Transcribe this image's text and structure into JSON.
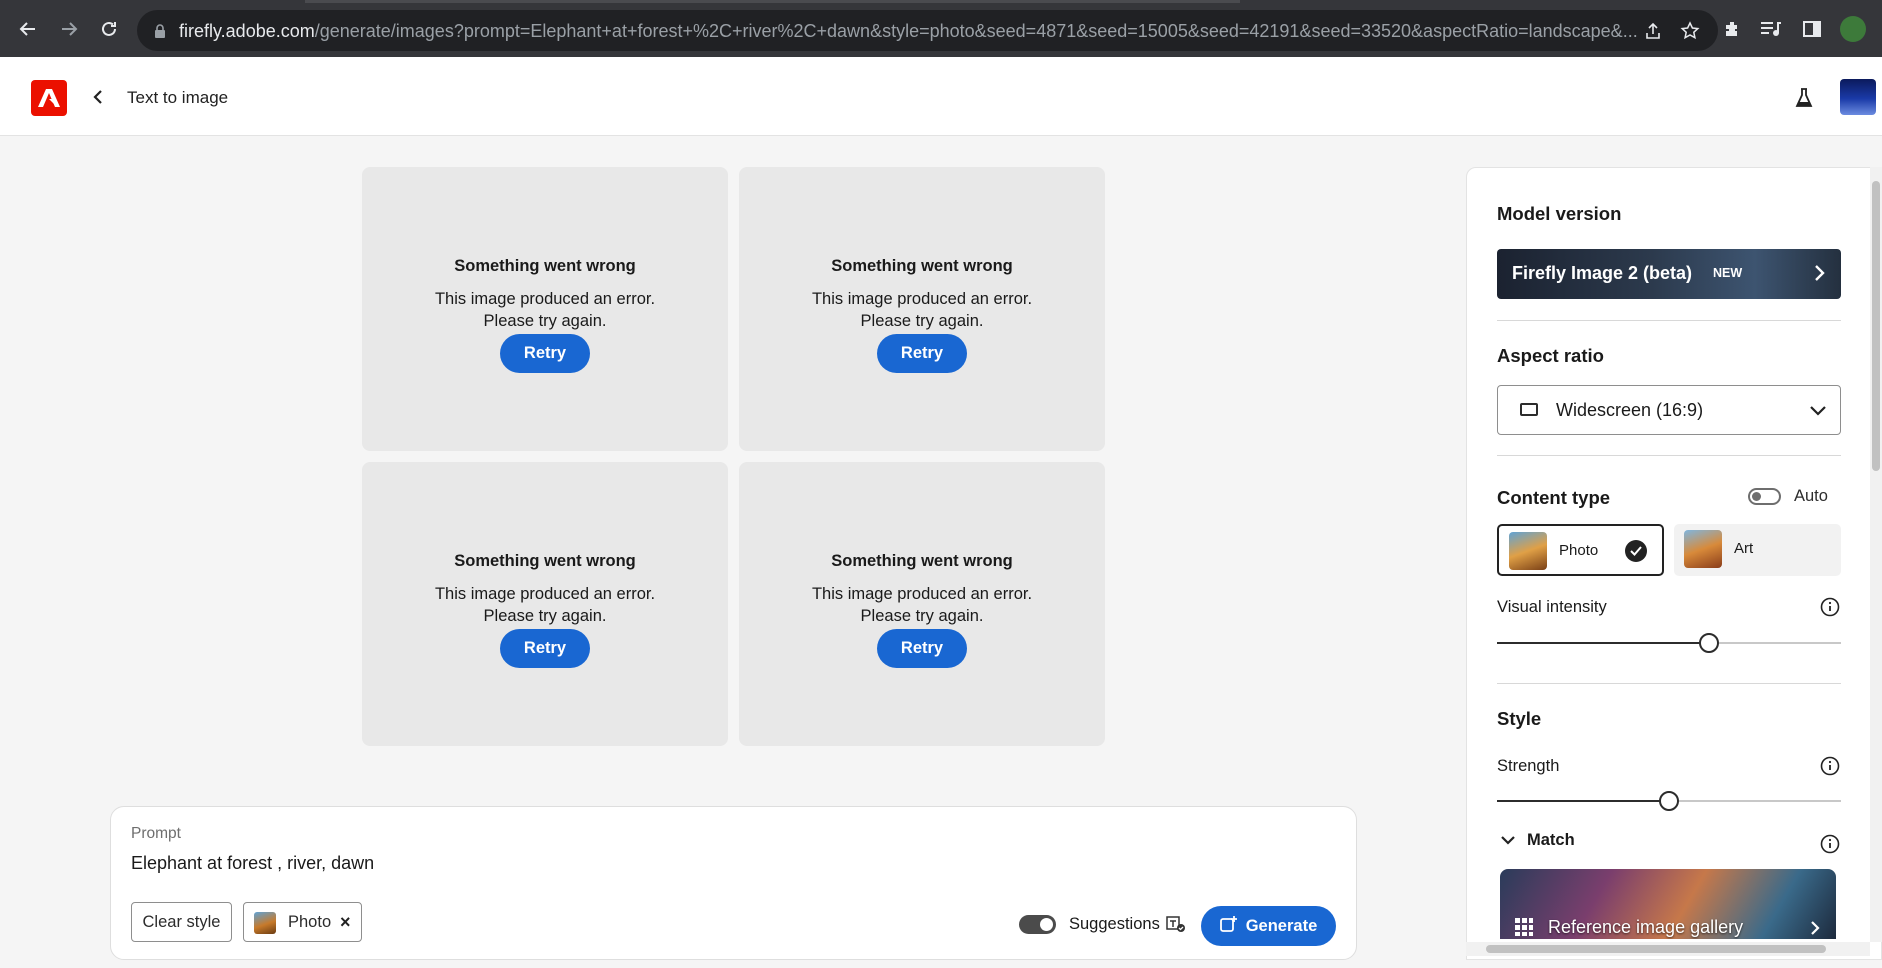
{
  "browser": {
    "url_host": "firefly.adobe.com",
    "url_path": "/generate/images?prompt=Elephant+at+forest+%2C+river%2C+dawn&style=photo&seed=4871&seed=15005&seed=42191&seed=33520&aspectRatio=landscape&..."
  },
  "header": {
    "title": "Text to image"
  },
  "tiles": [
    {
      "title": "Something went wrong",
      "line1": "This image produced an error.",
      "line2": "Please try again.",
      "retry": "Retry"
    },
    {
      "title": "Something went wrong",
      "line1": "This image produced an error.",
      "line2": "Please try again.",
      "retry": "Retry"
    },
    {
      "title": "Something went wrong",
      "line1": "This image produced an error.",
      "line2": "Please try again.",
      "retry": "Retry"
    },
    {
      "title": "Something went wrong",
      "line1": "This image produced an error.",
      "line2": "Please try again.",
      "retry": "Retry"
    }
  ],
  "prompt": {
    "label": "Prompt",
    "value": "Elephant at forest , river, dawn",
    "clear_style": "Clear style",
    "style_chip": "Photo",
    "suggestions_label": "Suggestions",
    "suggestions_on": true,
    "generate_label": "Generate"
  },
  "panel": {
    "model_title": "Model version",
    "model_name": "Firefly Image 2 (beta)",
    "model_badge": "NEW",
    "aspect_title": "Aspect ratio",
    "aspect_value": "Widescreen (16:9)",
    "content_title": "Content type",
    "auto_label": "Auto",
    "auto_on": false,
    "content_photo": "Photo",
    "content_art": "Art",
    "content_selected": "Photo",
    "visual_intensity_label": "Visual intensity",
    "visual_intensity_value": 0.615,
    "style_title": "Style",
    "strength_label": "Strength",
    "strength_value": 0.5,
    "match_label": "Match",
    "reference_gallery": "Reference image gallery"
  },
  "colors": {
    "accent": "#1967d2",
    "adobe_red": "#eb1000"
  }
}
